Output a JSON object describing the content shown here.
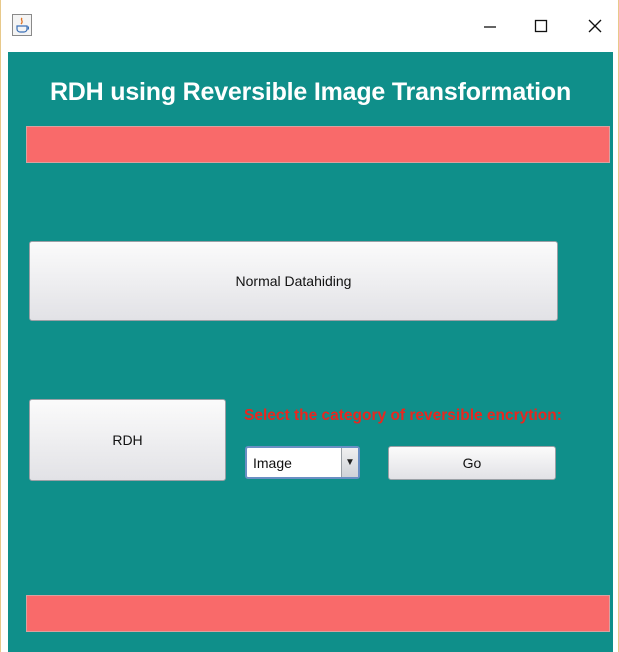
{
  "window": {
    "controls": {
      "minimize_icon": "minimize-icon",
      "maximize_icon": "maximize-icon",
      "close_icon": "close-icon"
    }
  },
  "main": {
    "title": "RDH using Reversible Image Transformation",
    "normal_button_label": "Normal Datahiding",
    "rdh_button_label": "RDH",
    "category_label": "Select the category of reversible encrytion:",
    "category_select": {
      "value": "Image"
    },
    "go_button_label": "Go"
  },
  "colors": {
    "background": "#0f8f8a",
    "status_bar": "#f96a6a",
    "label_red": "#e8271f"
  }
}
